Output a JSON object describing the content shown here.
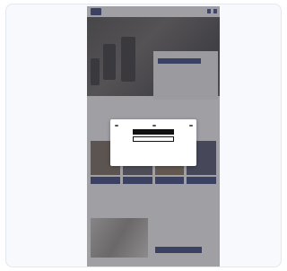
{
  "hero": {
    "kicker": "",
    "title": "",
    "cta": ""
  },
  "sections": {
    "intro_title": "",
    "secondary_title": "",
    "secondary_cta": ""
  },
  "cookie_modal": {
    "text": "",
    "options": [
      "",
      "",
      ""
    ],
    "accept_label": "",
    "settings_label": ""
  },
  "colors": {
    "brand": "#22306d",
    "overlay": "rgba(80,80,90,0.55)"
  }
}
